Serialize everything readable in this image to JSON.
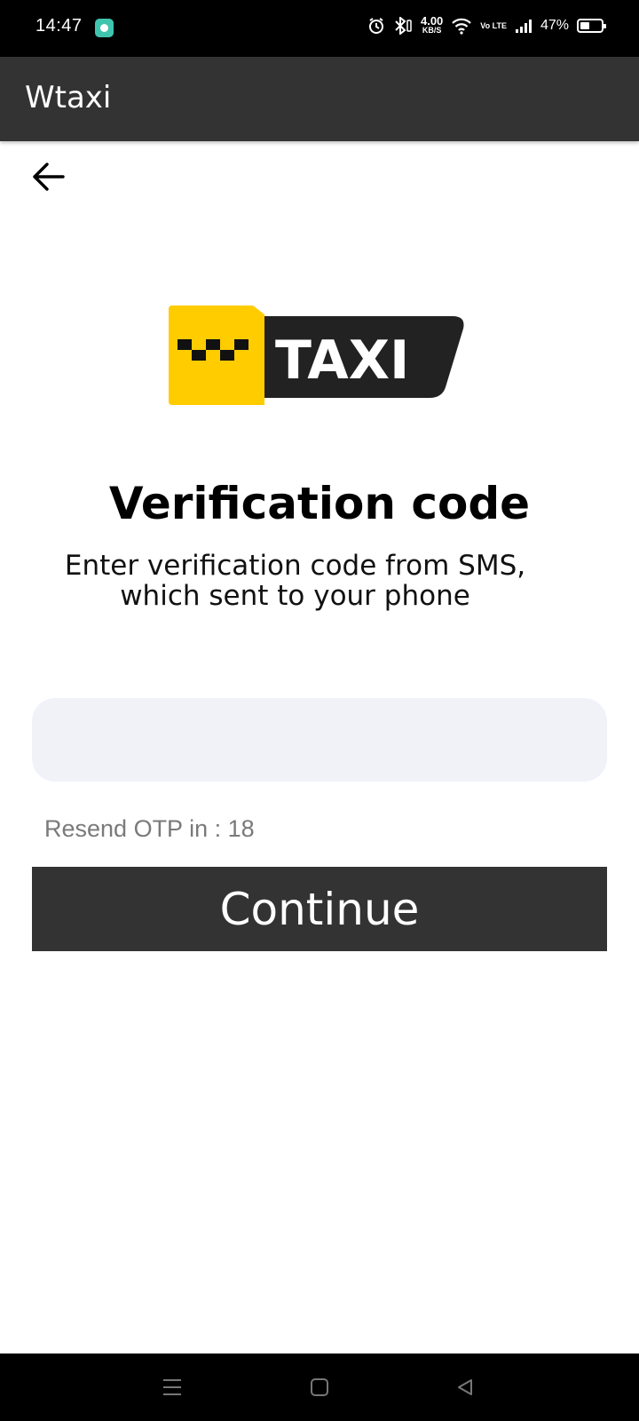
{
  "status_bar": {
    "time": "14:47",
    "net_speed_value": "4.00",
    "net_speed_unit": "KB/S",
    "volte_label": "Vo LTE",
    "battery_percent": "47%",
    "battery_level": 0.47,
    "icons": [
      "chat-app-icon",
      "alarm-icon",
      "bluetooth-icon",
      "wifi-icon",
      "signal-icon",
      "battery-icon"
    ]
  },
  "app_bar": {
    "title": "Wtaxi"
  },
  "navigation": {
    "back_icon": "arrow-left-icon"
  },
  "logo": {
    "text": "TAXI",
    "colors": {
      "yellow": "#FFCC00",
      "dark": "#222222",
      "text": "#ffffff"
    }
  },
  "main": {
    "heading": "Verification code",
    "subtitle_line1": "Enter verification code from SMS,",
    "subtitle_line2": "which sent to your phone",
    "otp_value": "",
    "otp_placeholder": "",
    "resend_text": "Resend OTP in : 18",
    "continue_label": "Continue"
  },
  "system_nav": {
    "icons": [
      "menu-icon",
      "home-icon",
      "back-triangle-icon"
    ]
  },
  "colors": {
    "primary": "#333333",
    "input_bg": "#F1F2F8",
    "muted_text": "#7A7A7A"
  }
}
